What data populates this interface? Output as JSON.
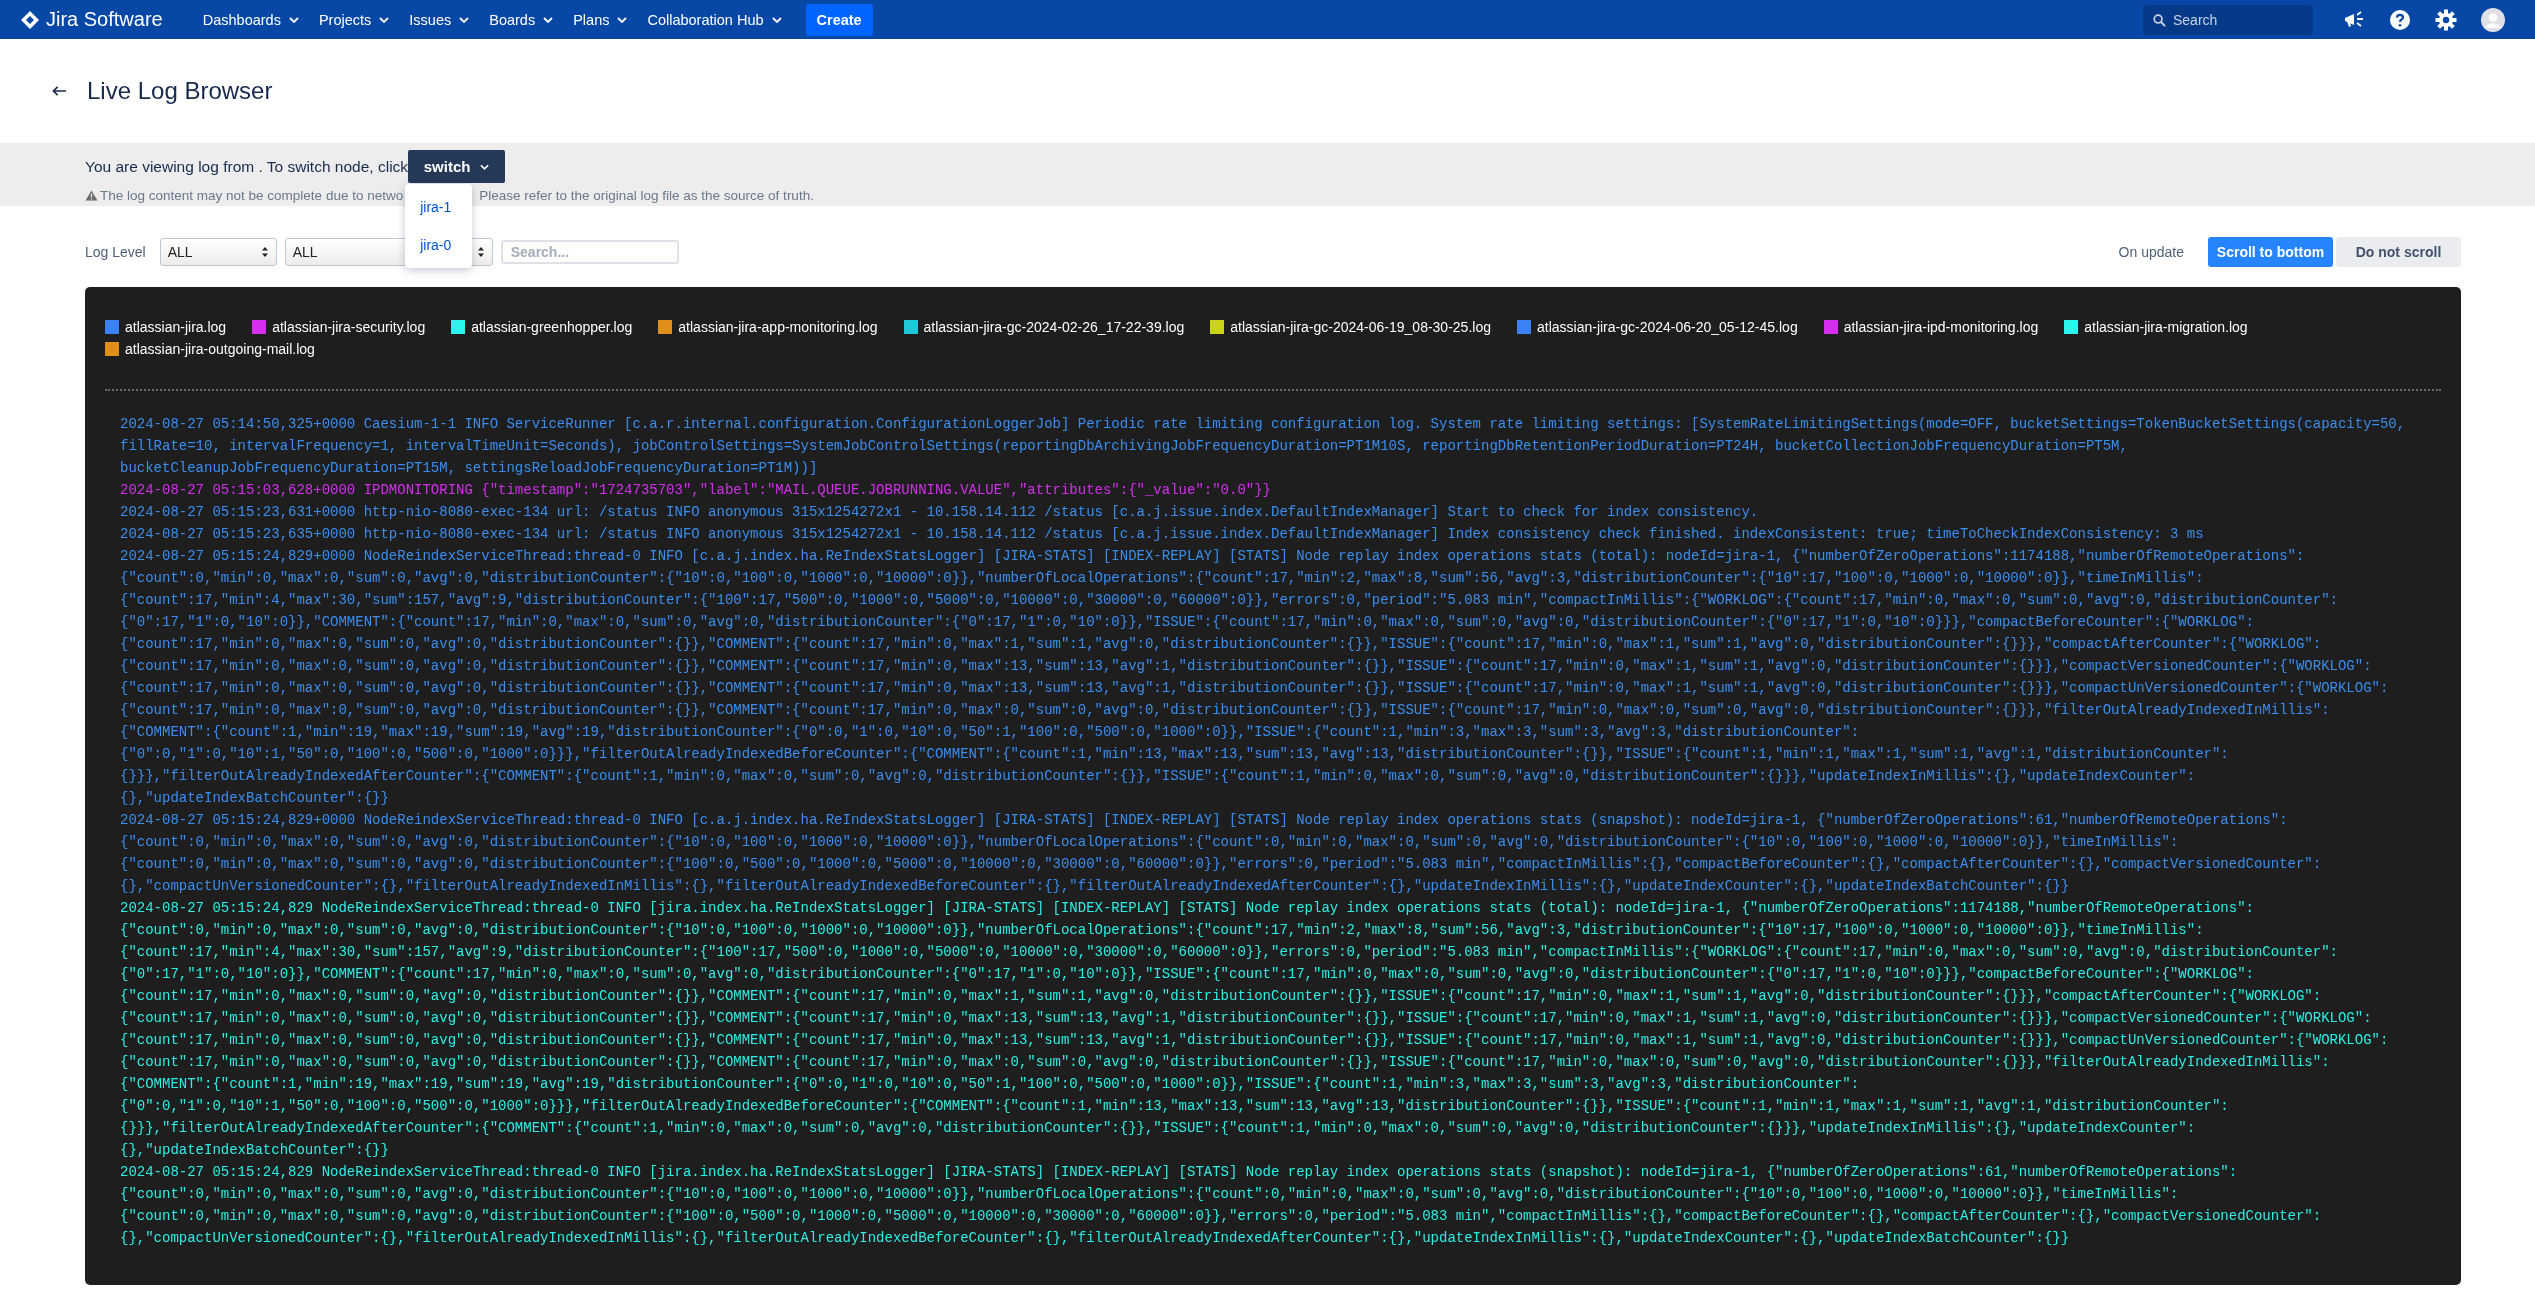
{
  "header": {
    "product": "Jira Software",
    "nav": [
      "Dashboards",
      "Projects",
      "Issues",
      "Boards",
      "Plans",
      "Collaboration Hub"
    ],
    "create": "Create",
    "search": {
      "placeholder": "Search"
    }
  },
  "page_title": "Live Log Browser",
  "node_bar": {
    "text": "You are viewing log from . To switch node, click",
    "switch": "switch",
    "menu": [
      "jira-1",
      "jira-0"
    ],
    "warning_before": "The log content may not be complete due to netwo",
    "warning_after": "Please refer to the original log file as the source of truth."
  },
  "filters": {
    "label": "Log Level",
    "selects": [
      "ALL",
      "ALL"
    ],
    "search": {
      "placeholder": "Search..."
    },
    "update_label": "On update",
    "update_options": [
      {
        "label": "Scroll to bottom",
        "selected": true
      },
      {
        "label": "Do not scroll",
        "selected": false
      }
    ]
  },
  "legend": [
    {
      "label": "atlassian-jira.log",
      "color": "#3b82f6"
    },
    {
      "label": "atlassian-jira-security.log",
      "color": "#d62ef0"
    },
    {
      "label": "atlassian-greenhopper.log",
      "color": "#2cf5ee"
    },
    {
      "label": "atlassian-jira-app-monitoring.log",
      "color": "#e0901a"
    },
    {
      "label": "atlassian-jira-gc-2024-02-26_17-22-39.log",
      "color": "#1ec8d8"
    },
    {
      "label": "atlassian-jira-gc-2024-06-19_08-30-25.log",
      "color": "#c8d414"
    },
    {
      "label": "atlassian-jira-gc-2024-06-20_05-12-45.log",
      "color": "#3b82f6"
    },
    {
      "label": "atlassian-jira-ipd-monitoring.log",
      "color": "#d62ef0"
    },
    {
      "label": "atlassian-jira-migration.log",
      "color": "#2cf5ee"
    },
    {
      "label": "atlassian-jira-outgoing-mail.log",
      "color": "#e0901a"
    }
  ],
  "log_entries": [
    {
      "color": "#3b8ef0",
      "lines": [
        "2024-08-27 05:14:50,325+0000 Caesium-1-1 INFO ServiceRunner [c.a.r.internal.configuration.ConfigurationLoggerJob] Periodic rate limiting configuration log. System rate limiting settings: [SystemRateLimitingSettings(mode=OFF, bucketSettings=TokenBucketSettings(capacity=50,",
        "fillRate=10, intervalFrequency=1, intervalTimeUnit=Seconds), jobControlSettings=SystemJobControlSettings(reportingDbArchivingJobFrequencyDuration=PT1M10S, reportingDbRetentionPeriodDuration=PT24H, bucketCollectionJobFrequencyDuration=PT5M,",
        "bucketCleanupJobFrequencyDuration=PT15M, settingsReloadJobFrequencyDuration=PT1M))]"
      ]
    },
    {
      "color": "#d62ef0",
      "lines": [
        "2024-08-27 05:15:03,628+0000 IPDMONITORING {\"timestamp\":\"1724735703\",\"label\":\"MAIL.QUEUE.JOBRUNNING.VALUE\",\"attributes\":{\"_value\":\"0.0\"}}"
      ]
    },
    {
      "color": "#3b8ef0",
      "lines": [
        "2024-08-27 05:15:23,631+0000 http-nio-8080-exec-134 url: /status INFO anonymous 315x1254272x1 - 10.158.14.112 /status [c.a.j.issue.index.DefaultIndexManager] Start to check for index consistency."
      ]
    },
    {
      "color": "#3b8ef0",
      "lines": [
        "2024-08-27 05:15:23,635+0000 http-nio-8080-exec-134 url: /status INFO anonymous 315x1254272x1 - 10.158.14.112 /status [c.a.j.issue.index.DefaultIndexManager] Index consistency check finished. indexConsistent: true; timeToCheckIndexConsistency: 3 ms"
      ]
    },
    {
      "color": "#3b8ef0",
      "lines": [
        "2024-08-27 05:15:24,829+0000 NodeReindexServiceThread:thread-0 INFO [c.a.j.index.ha.ReIndexStatsLogger] [JIRA-STATS] [INDEX-REPLAY] [STATS] Node replay index operations stats (total): nodeId=jira-1, {\"numberOfZeroOperations\":1174188,\"numberOfRemoteOperations\":",
        "{\"count\":0,\"min\":0,\"max\":0,\"sum\":0,\"avg\":0,\"distributionCounter\":{\"10\":0,\"100\":0,\"1000\":0,\"10000\":0}},\"numberOfLocalOperations\":{\"count\":17,\"min\":2,\"max\":8,\"sum\":56,\"avg\":3,\"distributionCounter\":{\"10\":17,\"100\":0,\"1000\":0,\"10000\":0}},\"timeInMillis\":",
        "{\"count\":17,\"min\":4,\"max\":30,\"sum\":157,\"avg\":9,\"distributionCounter\":{\"100\":17,\"500\":0,\"1000\":0,\"5000\":0,\"10000\":0,\"30000\":0,\"60000\":0}},\"errors\":0,\"period\":\"5.083 min\",\"compactInMillis\":{\"WORKLOG\":{\"count\":17,\"min\":0,\"max\":0,\"sum\":0,\"avg\":0,\"distributionCounter\":",
        "{\"0\":17,\"1\":0,\"10\":0}},\"COMMENT\":{\"count\":17,\"min\":0,\"max\":0,\"sum\":0,\"avg\":0,\"distributionCounter\":{\"0\":17,\"1\":0,\"10\":0}},\"ISSUE\":{\"count\":17,\"min\":0,\"max\":0,\"sum\":0,\"avg\":0,\"distributionCounter\":{\"0\":17,\"1\":0,\"10\":0}}},\"compactBeforeCounter\":{\"WORKLOG\":",
        "{\"count\":17,\"min\":0,\"max\":0,\"sum\":0,\"avg\":0,\"distributionCounter\":{}},\"COMMENT\":{\"count\":17,\"min\":0,\"max\":1,\"sum\":1,\"avg\":0,\"distributionCounter\":{}},\"ISSUE\":{\"count\":17,\"min\":0,\"max\":1,\"sum\":1,\"avg\":0,\"distributionCounter\":{}}},\"compactAfterCounter\":{\"WORKLOG\":",
        "{\"count\":17,\"min\":0,\"max\":0,\"sum\":0,\"avg\":0,\"distributionCounter\":{}},\"COMMENT\":{\"count\":17,\"min\":0,\"max\":13,\"sum\":13,\"avg\":1,\"distributionCounter\":{}},\"ISSUE\":{\"count\":17,\"min\":0,\"max\":1,\"sum\":1,\"avg\":0,\"distributionCounter\":{}}},\"compactVersionedCounter\":{\"WORKLOG\":",
        "{\"count\":17,\"min\":0,\"max\":0,\"sum\":0,\"avg\":0,\"distributionCounter\":{}},\"COMMENT\":{\"count\":17,\"min\":0,\"max\":13,\"sum\":13,\"avg\":1,\"distributionCounter\":{}},\"ISSUE\":{\"count\":17,\"min\":0,\"max\":1,\"sum\":1,\"avg\":0,\"distributionCounter\":{}}},\"compactUnVersionedCounter\":{\"WORKLOG\":",
        "{\"count\":17,\"min\":0,\"max\":0,\"sum\":0,\"avg\":0,\"distributionCounter\":{}},\"COMMENT\":{\"count\":17,\"min\":0,\"max\":0,\"sum\":0,\"avg\":0,\"distributionCounter\":{}},\"ISSUE\":{\"count\":17,\"min\":0,\"max\":0,\"sum\":0,\"avg\":0,\"distributionCounter\":{}}},\"filterOutAlreadyIndexedInMillis\":",
        "{\"COMMENT\":{\"count\":1,\"min\":19,\"max\":19,\"sum\":19,\"avg\":19,\"distributionCounter\":{\"0\":0,\"1\":0,\"10\":0,\"50\":1,\"100\":0,\"500\":0,\"1000\":0}},\"ISSUE\":{\"count\":1,\"min\":3,\"max\":3,\"sum\":3,\"avg\":3,\"distributionCounter\":",
        "{\"0\":0,\"1\":0,\"10\":1,\"50\":0,\"100\":0,\"500\":0,\"1000\":0}}},\"filterOutAlreadyIndexedBeforeCounter\":{\"COMMENT\":{\"count\":1,\"min\":13,\"max\":13,\"sum\":13,\"avg\":13,\"distributionCounter\":{}},\"ISSUE\":{\"count\":1,\"min\":1,\"max\":1,\"sum\":1,\"avg\":1,\"distributionCounter\":",
        "{}}},\"filterOutAlreadyIndexedAfterCounter\":{\"COMMENT\":{\"count\":1,\"min\":0,\"max\":0,\"sum\":0,\"avg\":0,\"distributionCounter\":{}},\"ISSUE\":{\"count\":1,\"min\":0,\"max\":0,\"sum\":0,\"avg\":0,\"distributionCounter\":{}}},\"updateIndexInMillis\":{},\"updateIndexCounter\":",
        "{},\"updateIndexBatchCounter\":{}}"
      ]
    },
    {
      "color": "#3b8ef0",
      "lines": [
        "2024-08-27 05:15:24,829+0000 NodeReindexServiceThread:thread-0 INFO [c.a.j.index.ha.ReIndexStatsLogger] [JIRA-STATS] [INDEX-REPLAY] [STATS] Node replay index operations stats (snapshot): nodeId=jira-1, {\"numberOfZeroOperations\":61,\"numberOfRemoteOperations\":",
        "{\"count\":0,\"min\":0,\"max\":0,\"sum\":0,\"avg\":0,\"distributionCounter\":{\"10\":0,\"100\":0,\"1000\":0,\"10000\":0}},\"numberOfLocalOperations\":{\"count\":0,\"min\":0,\"max\":0,\"sum\":0,\"avg\":0,\"distributionCounter\":{\"10\":0,\"100\":0,\"1000\":0,\"10000\":0}},\"timeInMillis\":",
        "{\"count\":0,\"min\":0,\"max\":0,\"sum\":0,\"avg\":0,\"distributionCounter\":{\"100\":0,\"500\":0,\"1000\":0,\"5000\":0,\"10000\":0,\"30000\":0,\"60000\":0}},\"errors\":0,\"period\":\"5.083 min\",\"compactInMillis\":{},\"compactBeforeCounter\":{},\"compactAfterCounter\":{},\"compactVersionedCounter\":",
        "{},\"compactUnVersionedCounter\":{},\"filterOutAlreadyIndexedInMillis\":{},\"filterOutAlreadyIndexedBeforeCounter\":{},\"filterOutAlreadyIndexedAfterCounter\":{},\"updateIndexInMillis\":{},\"updateIndexCounter\":{},\"updateIndexBatchCounter\":{}}"
      ]
    },
    {
      "color": "#2cf0e6",
      "lines": [
        "2024-08-27 05:15:24,829 NodeReindexServiceThread:thread-0 INFO [jira.index.ha.ReIndexStatsLogger] [JIRA-STATS] [INDEX-REPLAY] [STATS] Node replay index operations stats (total): nodeId=jira-1, {\"numberOfZeroOperations\":1174188,\"numberOfRemoteOperations\":",
        "{\"count\":0,\"min\":0,\"max\":0,\"sum\":0,\"avg\":0,\"distributionCounter\":{\"10\":0,\"100\":0,\"1000\":0,\"10000\":0}},\"numberOfLocalOperations\":{\"count\":17,\"min\":2,\"max\":8,\"sum\":56,\"avg\":3,\"distributionCounter\":{\"10\":17,\"100\":0,\"1000\":0,\"10000\":0}},\"timeInMillis\":",
        "{\"count\":17,\"min\":4,\"max\":30,\"sum\":157,\"avg\":9,\"distributionCounter\":{\"100\":17,\"500\":0,\"1000\":0,\"5000\":0,\"10000\":0,\"30000\":0,\"60000\":0}},\"errors\":0,\"period\":\"5.083 min\",\"compactInMillis\":{\"WORKLOG\":{\"count\":17,\"min\":0,\"max\":0,\"sum\":0,\"avg\":0,\"distributionCounter\":",
        "{\"0\":17,\"1\":0,\"10\":0}},\"COMMENT\":{\"count\":17,\"min\":0,\"max\":0,\"sum\":0,\"avg\":0,\"distributionCounter\":{\"0\":17,\"1\":0,\"10\":0}},\"ISSUE\":{\"count\":17,\"min\":0,\"max\":0,\"sum\":0,\"avg\":0,\"distributionCounter\":{\"0\":17,\"1\":0,\"10\":0}}},\"compactBeforeCounter\":{\"WORKLOG\":",
        "{\"count\":17,\"min\":0,\"max\":0,\"sum\":0,\"avg\":0,\"distributionCounter\":{}},\"COMMENT\":{\"count\":17,\"min\":0,\"max\":1,\"sum\":1,\"avg\":0,\"distributionCounter\":{}},\"ISSUE\":{\"count\":17,\"min\":0,\"max\":1,\"sum\":1,\"avg\":0,\"distributionCounter\":{}}},\"compactAfterCounter\":{\"WORKLOG\":",
        "{\"count\":17,\"min\":0,\"max\":0,\"sum\":0,\"avg\":0,\"distributionCounter\":{}},\"COMMENT\":{\"count\":17,\"min\":0,\"max\":13,\"sum\":13,\"avg\":1,\"distributionCounter\":{}},\"ISSUE\":{\"count\":17,\"min\":0,\"max\":1,\"sum\":1,\"avg\":0,\"distributionCounter\":{}}},\"compactVersionedCounter\":{\"WORKLOG\":",
        "{\"count\":17,\"min\":0,\"max\":0,\"sum\":0,\"avg\":0,\"distributionCounter\":{}},\"COMMENT\":{\"count\":17,\"min\":0,\"max\":13,\"sum\":13,\"avg\":1,\"distributionCounter\":{}},\"ISSUE\":{\"count\":17,\"min\":0,\"max\":1,\"sum\":1,\"avg\":0,\"distributionCounter\":{}}},\"compactUnVersionedCounter\":{\"WORKLOG\":",
        "{\"count\":17,\"min\":0,\"max\":0,\"sum\":0,\"avg\":0,\"distributionCounter\":{}},\"COMMENT\":{\"count\":17,\"min\":0,\"max\":0,\"sum\":0,\"avg\":0,\"distributionCounter\":{}},\"ISSUE\":{\"count\":17,\"min\":0,\"max\":0,\"sum\":0,\"avg\":0,\"distributionCounter\":{}}},\"filterOutAlreadyIndexedInMillis\":",
        "{\"COMMENT\":{\"count\":1,\"min\":19,\"max\":19,\"sum\":19,\"avg\":19,\"distributionCounter\":{\"0\":0,\"1\":0,\"10\":0,\"50\":1,\"100\":0,\"500\":0,\"1000\":0}},\"ISSUE\":{\"count\":1,\"min\":3,\"max\":3,\"sum\":3,\"avg\":3,\"distributionCounter\":",
        "{\"0\":0,\"1\":0,\"10\":1,\"50\":0,\"100\":0,\"500\":0,\"1000\":0}}},\"filterOutAlreadyIndexedBeforeCounter\":{\"COMMENT\":{\"count\":1,\"min\":13,\"max\":13,\"sum\":13,\"avg\":13,\"distributionCounter\":{}},\"ISSUE\":{\"count\":1,\"min\":1,\"max\":1,\"sum\":1,\"avg\":1,\"distributionCounter\":",
        "{}}},\"filterOutAlreadyIndexedAfterCounter\":{\"COMMENT\":{\"count\":1,\"min\":0,\"max\":0,\"sum\":0,\"avg\":0,\"distributionCounter\":{}},\"ISSUE\":{\"count\":1,\"min\":0,\"max\":0,\"sum\":0,\"avg\":0,\"distributionCounter\":{}}},\"updateIndexInMillis\":{},\"updateIndexCounter\":",
        "{},\"updateIndexBatchCounter\":{}}"
      ]
    },
    {
      "color": "#2cf0e6",
      "lines": [
        "2024-08-27 05:15:24,829 NodeReindexServiceThread:thread-0 INFO [jira.index.ha.ReIndexStatsLogger] [JIRA-STATS] [INDEX-REPLAY] [STATS] Node replay index operations stats (snapshot): nodeId=jira-1, {\"numberOfZeroOperations\":61,\"numberOfRemoteOperations\":",
        "{\"count\":0,\"min\":0,\"max\":0,\"sum\":0,\"avg\":0,\"distributionCounter\":{\"10\":0,\"100\":0,\"1000\":0,\"10000\":0}},\"numberOfLocalOperations\":{\"count\":0,\"min\":0,\"max\":0,\"sum\":0,\"avg\":0,\"distributionCounter\":{\"10\":0,\"100\":0,\"1000\":0,\"10000\":0}},\"timeInMillis\":",
        "{\"count\":0,\"min\":0,\"max\":0,\"sum\":0,\"avg\":0,\"distributionCounter\":{\"100\":0,\"500\":0,\"1000\":0,\"5000\":0,\"10000\":0,\"30000\":0,\"60000\":0}},\"errors\":0,\"period\":\"5.083 min\",\"compactInMillis\":{},\"compactBeforeCounter\":{},\"compactAfterCounter\":{},\"compactVersionedCounter\":",
        "{},\"compactUnVersionedCounter\":{},\"filterOutAlreadyIndexedInMillis\":{},\"filterOutAlreadyIndexedBeforeCounter\":{},\"filterOutAlreadyIndexedAfterCounter\":{},\"updateIndexInMillis\":{},\"updateIndexCounter\":{},\"updateIndexBatchCounter\":{}}"
      ]
    }
  ]
}
